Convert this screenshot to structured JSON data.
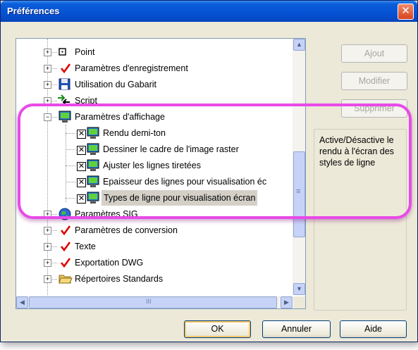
{
  "window": {
    "title": "Préférences",
    "close_symbol": "✕"
  },
  "tree": {
    "items": [
      {
        "label": "Point",
        "expander": "+",
        "icon": "point-box-icon"
      },
      {
        "label": "Paramètres d'enregistrement",
        "expander": "+",
        "icon": "red-check-icon"
      },
      {
        "label": "Utilisation du Gabarit",
        "expander": "+",
        "icon": "floppy-disk-icon"
      },
      {
        "label": "Script",
        "expander": "+",
        "icon": "script-arrows-icon"
      },
      {
        "label": "Paramètres d'affichage",
        "expander": "−",
        "icon": "monitor-icon"
      },
      {
        "label": "Rendu demi-ton",
        "icon": "monitor-icon",
        "checked": true
      },
      {
        "label": "Dessiner le cadre de l'image raster",
        "icon": "monitor-icon",
        "checked": true
      },
      {
        "label": "Ajuster les lignes tiretées",
        "icon": "monitor-icon",
        "checked": true
      },
      {
        "label": "Epaisseur des lignes pour visualisation éc",
        "icon": "monitor-icon",
        "checked": true
      },
      {
        "label": "Types de ligne pour visualisation écran",
        "icon": "monitor-icon",
        "checked": true,
        "selected": true
      },
      {
        "label": "Paramètres SIG",
        "expander": "+",
        "icon": "globe-icon"
      },
      {
        "label": "Paramètres de conversion",
        "expander": "+",
        "icon": "red-check-icon"
      },
      {
        "label": "Texte",
        "expander": "+",
        "icon": "red-check-icon"
      },
      {
        "label": "Exportation DWG",
        "expander": "+",
        "icon": "red-check-icon"
      },
      {
        "label": "Répertoires Standards",
        "expander": "+",
        "icon": "folder-icon"
      }
    ],
    "check_mark": "✕",
    "scroll_up": "▲",
    "scroll_down": "▼",
    "scroll_left": "◀",
    "scroll_right": "▶",
    "hscroll_grip": "III",
    "vscroll_grip": "≡"
  },
  "side_buttons": {
    "add": "Ajout",
    "modify": "Modifier",
    "delete": "Supprimer"
  },
  "description": "Active/Désactive le rendu à l'écran des styles de ligne",
  "footer": {
    "ok": "OK",
    "cancel": "Annuler",
    "help": "Aide"
  },
  "colors": {
    "highlight": "#e84ae8",
    "check": "#e00000",
    "title_bar": "#0552d5"
  }
}
